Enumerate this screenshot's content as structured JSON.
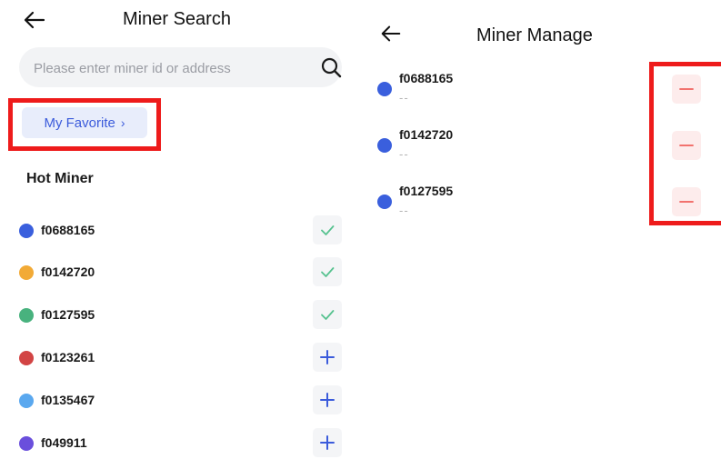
{
  "search_screen": {
    "title": "Miner Search",
    "back_icon": "arrow-left-icon",
    "search": {
      "placeholder": "Please enter miner id or address",
      "value": "",
      "icon": "search-icon"
    },
    "favorite_label": "My Favorite",
    "favorite_chevron": "›",
    "section_title": "Hot Miner",
    "miners": [
      {
        "id": "f0688165",
        "color": "#3a5fdd",
        "action": "check",
        "action_icon": "check-icon"
      },
      {
        "id": "f0142720",
        "color": "#f2aa36",
        "action": "check",
        "action_icon": "check-icon"
      },
      {
        "id": "f0127595",
        "color": "#48b27e",
        "action": "check",
        "action_icon": "check-icon"
      },
      {
        "id": "f0123261",
        "color": "#d24444",
        "action": "add",
        "action_icon": "plus-icon"
      },
      {
        "id": "f0135467",
        "color": "#5aa8ef",
        "action": "add",
        "action_icon": "plus-icon"
      },
      {
        "id": "f049911",
        "color": "#6a4fdc",
        "action": "add",
        "action_icon": "plus-icon"
      }
    ]
  },
  "manage_screen": {
    "title": "Miner Manage",
    "back_icon": "arrow-left-icon",
    "miners": [
      {
        "id": "f0688165",
        "sub": "--",
        "color": "#3a5fdd",
        "action_icon": "minus-icon"
      },
      {
        "id": "f0142720",
        "sub": "--",
        "color": "#3a5fdd",
        "action_icon": "minus-icon"
      },
      {
        "id": "f0127595",
        "sub": "--",
        "color": "#3a5fdd",
        "action_icon": "minus-icon"
      }
    ]
  },
  "colors": {
    "accent_blue": "#3b5bdb",
    "check_green": "#56c28f",
    "plus_blue": "#3b5bdb",
    "remove_red": "#f0605c",
    "highlight_red": "#ee1b1b",
    "search_bg": "#f2f3f5",
    "favorite_bg": "#e8edfb",
    "remove_bg": "#fdecec"
  }
}
